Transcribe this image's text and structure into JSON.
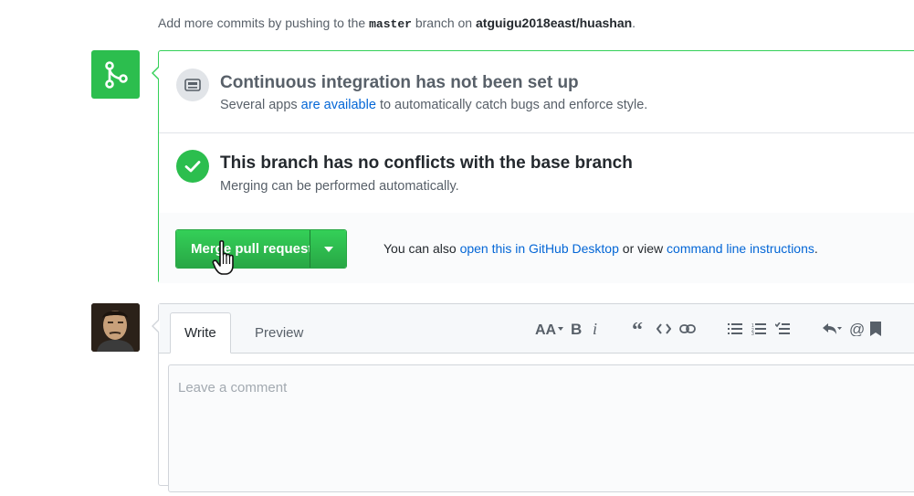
{
  "hint": {
    "prefix": "Add more commits by pushing to the",
    "branch": "master",
    "middle": "branch on",
    "repo": "atguigu2018east/huashan",
    "suffix": "."
  },
  "ci": {
    "title": "Continuous integration has not been set up",
    "desc_prefix": "Several apps",
    "desc_link": "are available",
    "desc_suffix": "to automatically catch bugs and enforce style."
  },
  "conflicts": {
    "title": "This branch has no conflicts with the base branch",
    "desc": "Merging can be performed automatically."
  },
  "merge_action": {
    "button_label": "Merge pull request",
    "text_prefix": "You can also",
    "desktop_link": "open this in GitHub Desktop",
    "text_middle": "or view",
    "cli_link": "command line instructions",
    "text_suffix": "."
  },
  "comment": {
    "tabs": [
      "Write",
      "Preview"
    ],
    "placeholder": "Leave a comment"
  },
  "toolbar_icons": [
    "header-icon",
    "bold-icon",
    "italic-icon",
    "quote-icon",
    "code-icon",
    "link-icon",
    "unordered-list-icon",
    "ordered-list-icon",
    "task-list-icon",
    "reply-icon",
    "mention-icon",
    "saved-reply-icon"
  ],
  "colors": {
    "accent_green": "#2cbe4e",
    "link_blue": "#0366d6"
  }
}
